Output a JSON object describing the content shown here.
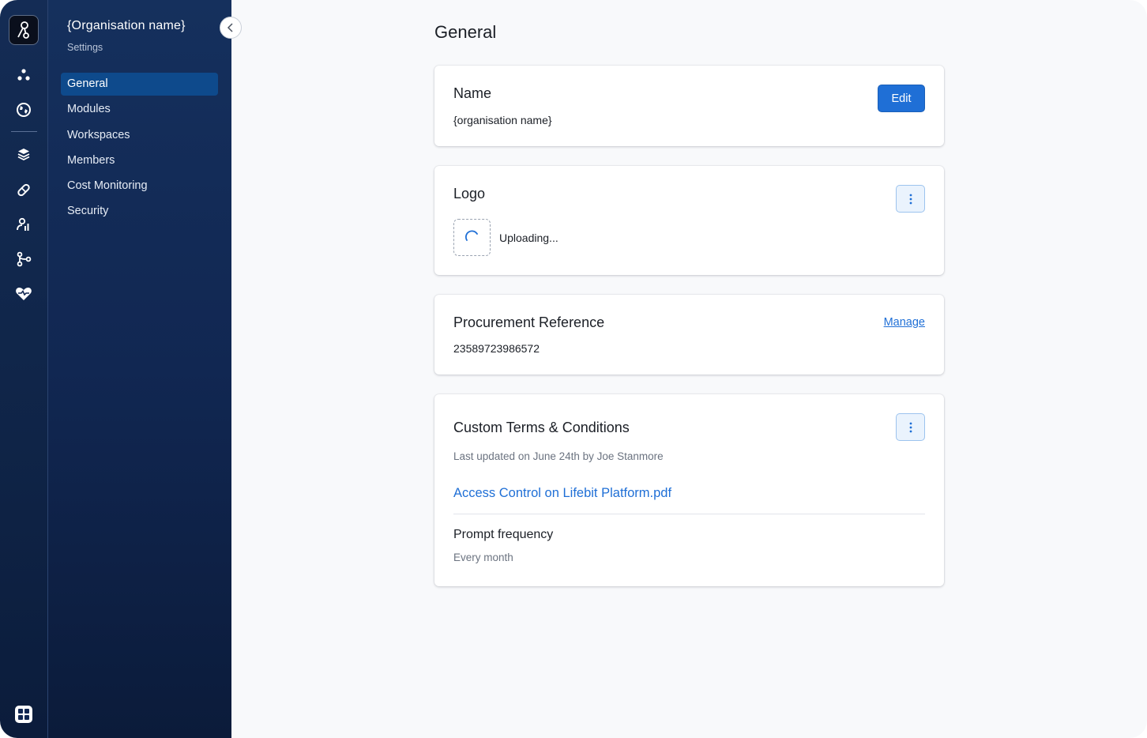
{
  "sidebar": {
    "org_name": "{Organisation name}",
    "subtitle": "Settings",
    "items": [
      {
        "label": "General",
        "active": true
      },
      {
        "label": "Modules",
        "active": false
      },
      {
        "label": "Workspaces",
        "active": false
      },
      {
        "label": "Members",
        "active": false
      },
      {
        "label": "Cost Monitoring",
        "active": false
      },
      {
        "label": "Security",
        "active": false
      }
    ]
  },
  "rail": {
    "icons": [
      "app-logo-icon",
      "dots-icon",
      "globe-icon",
      "layers-icon",
      "pill-icon",
      "analyst-icon",
      "git-branch-icon",
      "heart-health-icon",
      "apps-grid-icon"
    ]
  },
  "main": {
    "title": "General",
    "name_card": {
      "title": "Name",
      "value": "{organisation name}",
      "edit_label": "Edit"
    },
    "logo_card": {
      "title": "Logo",
      "status": "Uploading..."
    },
    "procurement_card": {
      "title": "Procurement Reference",
      "value": "23589723986572",
      "manage_label": "Manage"
    },
    "terms_card": {
      "title": "Custom Terms & Conditions",
      "updated": "Last updated on June 24th by Joe Stanmore",
      "file_link": "Access Control on Lifebit Platform.pdf",
      "frequency_title": "Prompt frequency",
      "frequency_value": "Every month"
    }
  },
  "colors": {
    "accent": "#1f6fd6",
    "sidebar_bg": "#112752",
    "active_item": "#0e4a8c"
  }
}
